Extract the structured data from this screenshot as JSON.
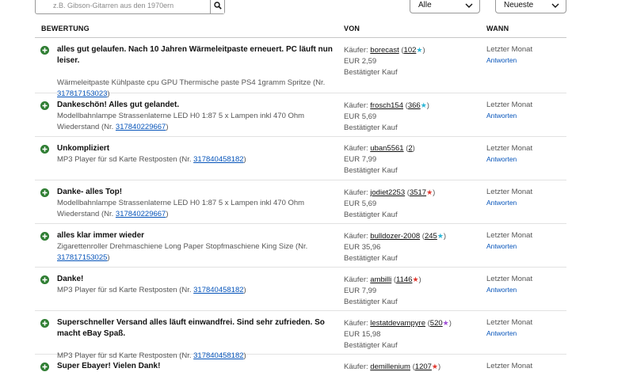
{
  "search": {
    "placeholder": "z.B. Gibson-Gitarren aus den 1970ern"
  },
  "filter": {
    "selected": "Alle"
  },
  "sort": {
    "selected": "Neueste"
  },
  "columns": {
    "rating": "BEWERTUNG",
    "from": "VON",
    "when": "WANN"
  },
  "colors": {
    "positive": "#2e7d32",
    "link": "#0654ba",
    "star_turquoise": "#2bb5d6",
    "star_red": "#e0362d",
    "star_purple": "#a04fd6"
  },
  "rows": [
    {
      "comment": "alles gut gelaufen. Nach 10 Jahren Wärmeleitpaste erneuert. PC läuft nun leiser.",
      "item_text": "Wärmeleitpaste Kühlpaste cpu GPU Thermische paste PS4 1gramm Spritze (Nr. ",
      "item_number": "317817153023",
      "buyer_prefix": "Käufer: ",
      "buyer": "borecast",
      "score": "102",
      "star": "★",
      "star_color": "turquoise",
      "price": "EUR 2,59",
      "status": "Bestätigter Kauf",
      "when": "Letzter Monat",
      "reply": "Antworten"
    },
    {
      "comment": "Dankeschön! Alles gut gelandet.",
      "item_text": "Modellbahnlampe Strassenlaterne LED H0 1:87 5 x Lampen inkl 470 Ohm Wiederstand (Nr. ",
      "item_number": "317840229667",
      "buyer_prefix": "Käufer: ",
      "buyer": "frosch154",
      "score": "366",
      "star": "★",
      "star_color": "turquoise",
      "price": "EUR 5,69",
      "status": "Bestätigter Kauf",
      "when": "Letzter Monat",
      "reply": "Antworten"
    },
    {
      "comment": "Unkompliziert",
      "item_text": "MP3 Player für sd Karte Restposten (Nr. ",
      "item_number": "317840458182",
      "buyer_prefix": "Käufer: ",
      "buyer": "uban5561",
      "score": "2",
      "star": "",
      "star_color": "none",
      "price": "EUR 7,99",
      "status": "Bestätigter Kauf",
      "when": "Letzter Monat",
      "reply": "Antworten"
    },
    {
      "comment": "Danke- alles Top!",
      "item_text": "Modellbahnlampe Strassenlaterne LED H0 1:87 5 x Lampen inkl 470 Ohm Wiederstand (Nr. ",
      "item_number": "317840229667",
      "buyer_prefix": "Käufer: ",
      "buyer": "jodiet2253",
      "score": "3517",
      "star": "★",
      "star_color": "red",
      "price": "EUR 5,69",
      "status": "Bestätigter Kauf",
      "when": "Letzter Monat",
      "reply": "Antworten"
    },
    {
      "comment": "alles klar immer wieder",
      "item_text": "Zigarettenroller Drehmaschiene Long Paper Stopfmaschiene King Size (Nr. ",
      "item_number": "317817153025",
      "buyer_prefix": "Käufer: ",
      "buyer": "bulldozer-2008",
      "score": "245",
      "star": "★",
      "star_color": "turquoise",
      "price": "EUR 35,96",
      "status": "Bestätigter Kauf",
      "when": "Letzter Monat",
      "reply": "Antworten"
    },
    {
      "comment": "Danke!",
      "item_text": "MP3 Player für sd Karte Restposten (Nr. ",
      "item_number": "317840458182",
      "buyer_prefix": "Käufer: ",
      "buyer": "ambilli",
      "score": "1146",
      "star": "★",
      "star_color": "red",
      "price": "EUR 7,99",
      "status": "Bestätigter Kauf",
      "when": "Letzter Monat",
      "reply": "Antworten"
    },
    {
      "comment": "Superschneller Versand alles läuft einwandfrei. Sind sehr zufrieden. So macht eBay Spaß.",
      "item_text": "MP3 Player für sd Karte Restposten (Nr. ",
      "item_number": "317840458182",
      "buyer_prefix": "Käufer: ",
      "buyer": "lestatdevampyre",
      "score": "520",
      "star": "★",
      "star_color": "purple",
      "price": "EUR 15,98",
      "status": "Bestätigter Kauf",
      "when": "Letzter Monat",
      "reply": "Antworten"
    },
    {
      "comment": "Super Ebayer! Vielen Dank!",
      "item_text": "",
      "item_number": "",
      "buyer_prefix": "Käufer: ",
      "buyer": "demillenium",
      "score": "1207",
      "star": "★",
      "star_color": "red",
      "price": "",
      "status": "",
      "when": "Letzter Monat",
      "reply": ""
    }
  ]
}
